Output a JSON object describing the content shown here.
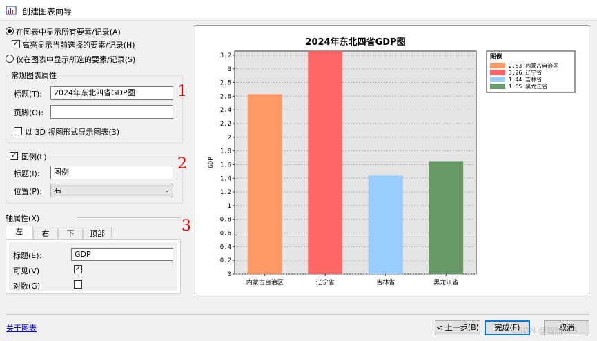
{
  "window": {
    "title": "创建图表向导"
  },
  "display_mode": {
    "all_label": "在图表中显示所有要素/记录(A)",
    "highlight_label": "高亮显示当前选择的要素/记录(H)",
    "selected_label": "仅在图表中显示所选的要素/记录(S)"
  },
  "general": {
    "group_label": "常规图表属性",
    "title_label": "标题(T):",
    "title_value": "2024年东北四省GDP图",
    "footer_label": "页脚(O):",
    "footer_value": "",
    "view3d_label": "以 3D 视图形式显示图表(3)"
  },
  "legend": {
    "group_label": "图例(L)",
    "title_label": "标题(I):",
    "title_value": "图例",
    "position_label": "位置(P):",
    "position_value": "右"
  },
  "axis": {
    "group_label": "轴属性(X)",
    "tabs": [
      "左",
      "右",
      "下",
      "顶部"
    ],
    "title_label": "标题(E):",
    "title_value": "GDP",
    "visible_label": "可见(V)",
    "visible_checked": true,
    "log_label": "对数(G)",
    "log_checked": false
  },
  "annotations": {
    "mark1": "1",
    "mark2": "2",
    "mark3": "3"
  },
  "footer": {
    "about_link": "关于图表",
    "back_label": "< 上一步(B)",
    "finish_label": "完成(F)",
    "cancel_label": "取消"
  },
  "watermark": "CSDN @智航GIS",
  "chart_data": {
    "type": "bar",
    "title": "2024年东北四省GDP图",
    "ylabel": "GDP",
    "xlabel": "",
    "categories": [
      "内蒙古自治区",
      "辽宁省",
      "吉林省",
      "黑龙江省"
    ],
    "values": [
      2.63,
      3.26,
      1.44,
      1.65
    ],
    "colors": [
      "#ff9966",
      "#ff6666",
      "#99ccff",
      "#669966"
    ],
    "ylim": [
      0,
      3.26
    ],
    "yticks": [
      "0",
      "0.2",
      "0.4",
      "0.6",
      "0.8",
      "1",
      "1.2",
      "1.4",
      "1.6",
      "1.8",
      "2",
      "2.2",
      "2.4",
      "2.6",
      "2.8",
      "3",
      "3.2"
    ],
    "grid": true,
    "plot_background": "#e4e4e4",
    "legend_title": "图例",
    "legend_labels": [
      "2.63 内蒙古自治区",
      "3.26 辽宁省",
      "1.44 吉林省",
      "1.65 黑龙江省"
    ],
    "legend_position": "top-right"
  }
}
